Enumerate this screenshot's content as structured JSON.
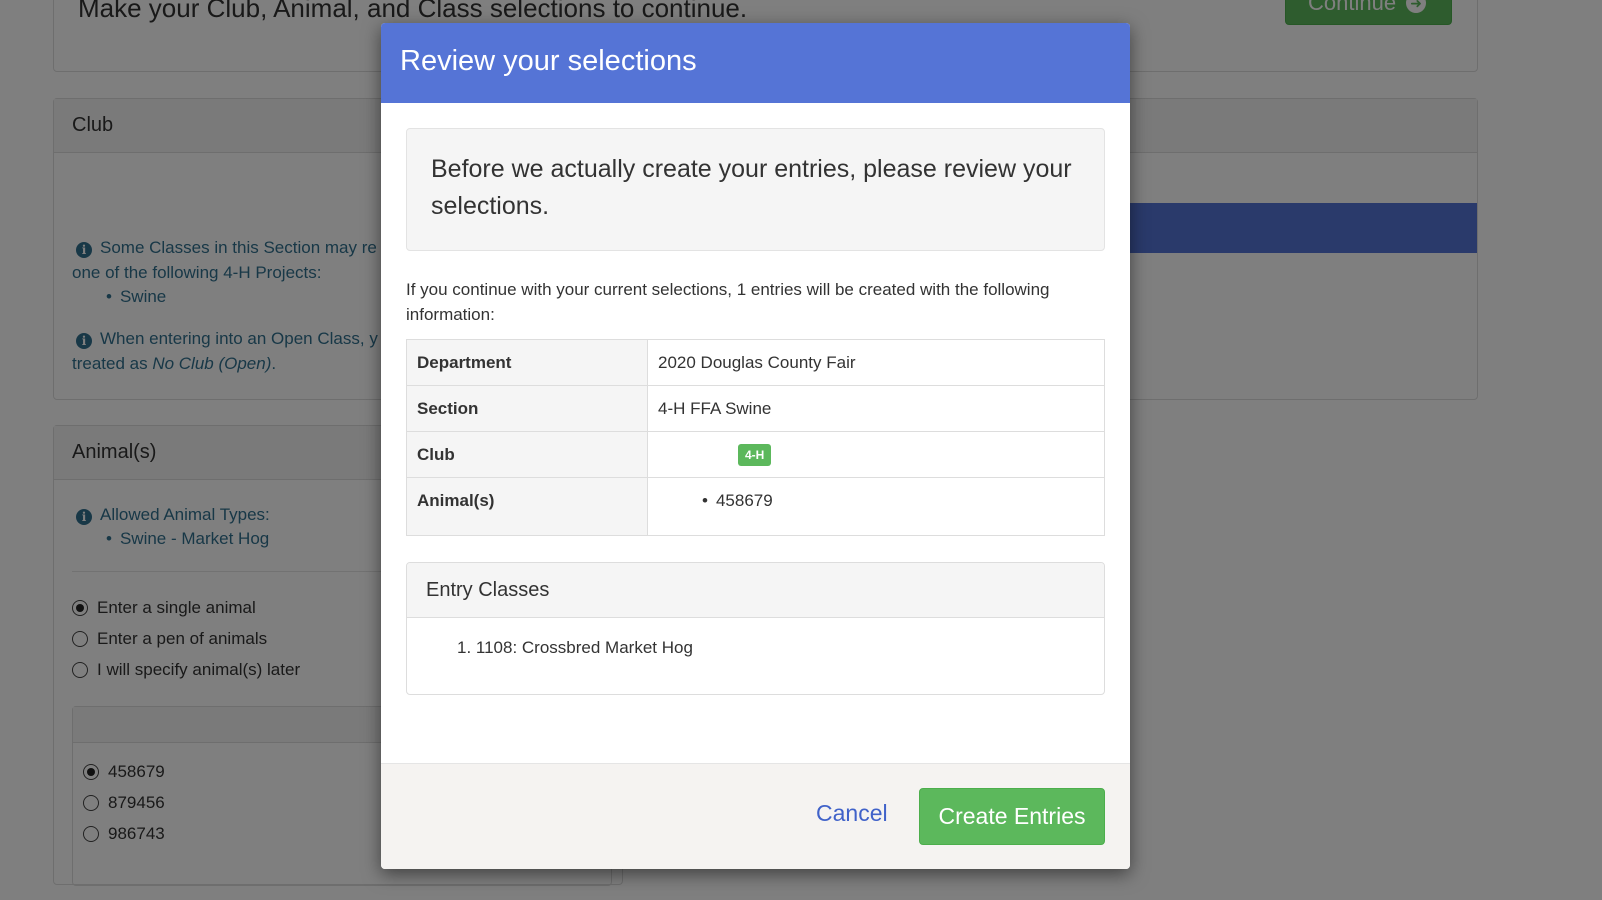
{
  "background": {
    "intro_text": "Make your Club, Animal, and Class selections to continue.",
    "continue_label": "Continue",
    "club_panel": {
      "title": "Club",
      "info1_line1": "Some Classes in this Section may re",
      "info1_line2": "one of the following 4-H Projects:",
      "info1_item": "Swine",
      "info2_line1": "When entering into an Open Class, y",
      "info2_line2_prefix": "treated as ",
      "info2_line2_em": "No Club (Open)",
      "info2_line2_suffix": "."
    },
    "animals_panel": {
      "title": "Animal(s)",
      "allowed_label": "Allowed Animal Types:",
      "allowed_item": "Swine - Market Hog",
      "options": [
        "Enter a single animal",
        "Enter a pen of animals",
        "I will specify animal(s) later"
      ],
      "animal_ids": [
        "458679",
        "879456",
        "986743"
      ]
    }
  },
  "modal": {
    "title": "Review your selections",
    "well_text": "Before we actually create your entries, please review your selections.",
    "note": "If you continue with your current selections, 1 entries will be created with the following information:",
    "rows": {
      "department_label": "Department",
      "department_value": "2020 Douglas County Fair",
      "section_label": "Section",
      "section_value": "4-H FFA Swine",
      "club_label": "Club",
      "club_badge": "4-H",
      "animals_label": "Animal(s)",
      "animal_value": "458679"
    },
    "entry_classes_title": "Entry Classes",
    "entry_class_item": "1. 1108: Crossbred Market Hog",
    "cancel_label": "Cancel",
    "create_label": "Create Entries"
  },
  "colors": {
    "modal_header": "#5574d6",
    "success_green": "#5cb85c",
    "link_blue": "#4062c9",
    "info_blue": "#31708f"
  }
}
